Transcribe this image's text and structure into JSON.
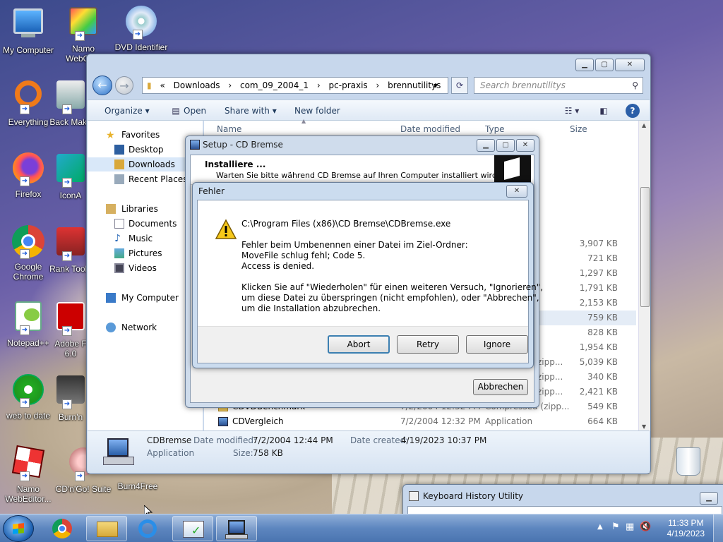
{
  "desktop": {
    "icons": [
      {
        "label": "My Computer"
      },
      {
        "label": "Namo WebCa..."
      },
      {
        "label": "DVD Identifier"
      },
      {
        "label": "Everything"
      },
      {
        "label": "Back Make"
      },
      {
        "label": "Firefox"
      },
      {
        "label": "IconA"
      },
      {
        "label": "Google Chrome"
      },
      {
        "label": "Rank Toolb"
      },
      {
        "label": "Notepad++"
      },
      {
        "label": "Adobe F 6.0"
      },
      {
        "label": "web to date"
      },
      {
        "label": "Burn'n"
      },
      {
        "label": "Namo WebEditor..."
      },
      {
        "label": "CD'n'Go! Suite"
      },
      {
        "label": "Burn4Free"
      },
      {
        "label": ""
      }
    ]
  },
  "explorer": {
    "address": [
      "«",
      "Downloads",
      "›",
      "com_09_2004_1",
      "›",
      "pc-praxis",
      "›",
      "brennutilitys"
    ],
    "search_placeholder": "Search brennutilitys",
    "toolbar": {
      "organize": "Organize",
      "open": "Open",
      "share": "Share with",
      "new_folder": "New folder"
    },
    "nav": {
      "favorites": "Favorites",
      "desktop": "Desktop",
      "downloads": "Downloads",
      "recent": "Recent Places",
      "libraries": "Libraries",
      "documents": "Documents",
      "music": "Music",
      "pictures": "Pictures",
      "videos": "Videos",
      "computer": "My Computer",
      "network": "Network"
    },
    "columns": {
      "name": "Name",
      "date": "Date modified",
      "type": "Type",
      "size": "Size"
    },
    "sizes": [
      "3,907 KB",
      "721 KB",
      "1,297 KB",
      "1,791 KB",
      "2,153 KB",
      "759 KB",
      "828 KB",
      "1,954 KB",
      "5,039 KB",
      "340 KB",
      "2,421 KB",
      "549 KB",
      "664 KB"
    ],
    "partial_types": [
      "zipp...",
      "zipp...",
      "zipp..."
    ],
    "files": [
      {
        "name": "CDVDBenchmark",
        "date": "7/2/2004 12:32 PM",
        "type": "Compressed (zipp...",
        "size": "549 KB"
      },
      {
        "name": "CDVergleich",
        "date": "7/2/2004 12:32 PM",
        "type": "Application",
        "size": "664 KB"
      }
    ],
    "details": {
      "name": "CDBremse",
      "type": "Application",
      "date_modified_label": "Date modified:",
      "date_modified": "7/2/2004 12:44 PM",
      "date_created_label": "Date created:",
      "date_created": "4/19/2023 10:37 PM",
      "size_label": "Size:",
      "size": "758 KB"
    }
  },
  "setup": {
    "title": "Setup - CD Bremse",
    "heading": "Installiere ...",
    "subheading": "Warten Sie bitte während CD Bremse auf Ihren Computer installiert wird.",
    "cancel": "Abbrechen"
  },
  "error": {
    "title": "Fehler",
    "path": "C:\\Program Files (x86)\\CD Bremse\\CDBremse.exe",
    "line1": "Fehler beim Umbenennen einer Datei im Ziel-Ordner:",
    "line2": "MoveFile schlug fehl; Code 5.",
    "line3": "Access is denied.",
    "line4": "Klicken Sie auf \"Wiederholen\" für einen weiteren Versuch, \"Ignorieren\",",
    "line5": "um diese Datei zu überspringen (nicht empfohlen), oder \"Abbrechen\",",
    "line6": "um die Installation abzubrechen.",
    "buttons": {
      "abort": "Abort",
      "retry": "Retry",
      "ignore": "Ignore"
    }
  },
  "keyboard_history": {
    "title": "Keyboard History Utility"
  },
  "taskbar": {
    "time": "11:33 PM",
    "date": "4/19/2023"
  }
}
